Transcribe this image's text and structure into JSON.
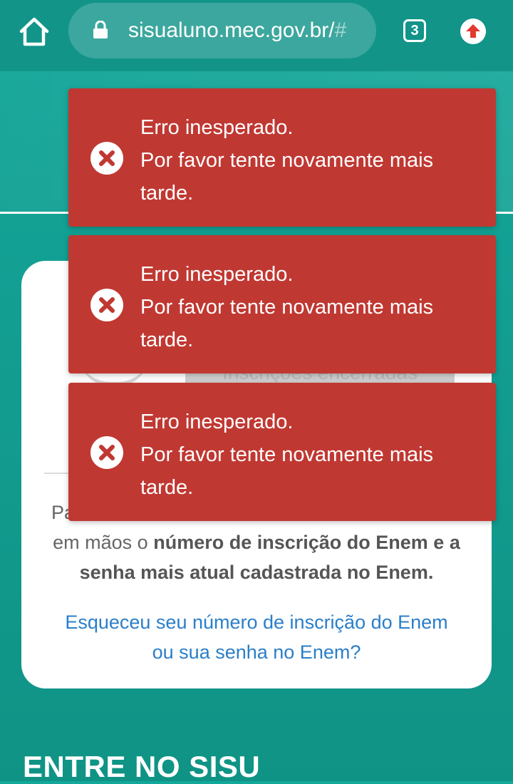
{
  "browser": {
    "url_main": "sisualuno.mec.gov.br/",
    "url_faded": "#",
    "tab_count": "3"
  },
  "card": {
    "graphic_text": "Inscrições encerradas",
    "intro_visible": "Pa",
    "intro_tail": "em mãos o ",
    "intro_bold_1": "número de inscrição do Enem e a",
    "intro_bold_2": "senha mais atual cadastrada no Enem.",
    "forgot_link_line1": "Esqueceu seu número de inscrição do Enem",
    "forgot_link_line2": "ou sua senha no Enem?"
  },
  "section_title": "ENTRE NO SISU",
  "toasts": [
    {
      "line1": "Erro inesperado.",
      "line2": "Por favor tente novamente mais",
      "line3": "tarde."
    },
    {
      "line1": "Erro inesperado.",
      "line2": "Por favor tente novamente mais",
      "line3": "tarde."
    },
    {
      "line1": "Erro inesperado.",
      "line2": "Por favor tente novamente mais",
      "line3": "tarde."
    }
  ],
  "colors": {
    "toast_bg": "#c03832",
    "page_bg": "#13a89a",
    "link": "#2a7fc9"
  }
}
